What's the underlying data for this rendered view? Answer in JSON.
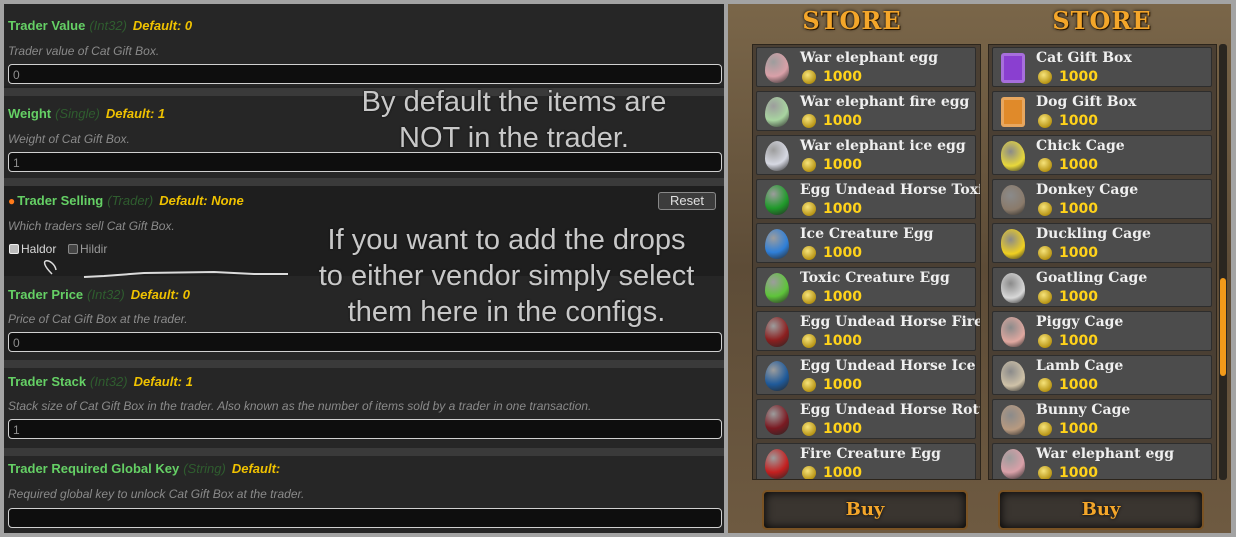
{
  "config": {
    "trader_value": {
      "title": "Trader Value",
      "type": "(Int32)",
      "default": "Default: 0",
      "description": "Trader value of Cat Gift Box.",
      "value": "0"
    },
    "weight": {
      "title": "Weight",
      "type": "(Single)",
      "default": "Default: 1",
      "description": "Weight of Cat Gift Box.",
      "value": "1"
    },
    "trader_selling": {
      "title": "Trader Selling",
      "type": "(Trader)",
      "default": "Default: None",
      "description": "Which traders sell Cat Gift Box.",
      "reset_label": "Reset",
      "options": [
        "Haldor",
        "Hildir"
      ]
    },
    "trader_price": {
      "title": "Trader Price",
      "type": "(Int32)",
      "default": "Default: 0",
      "description": "Price of Cat Gift Box at the trader.",
      "value": "0"
    },
    "trader_stack": {
      "title": "Trader Stack",
      "type": "(Int32)",
      "default": "Default: 1",
      "description": "Stack size of Cat Gift Box in the trader. Also known as the number of items sold by a trader in one transaction.",
      "value": "1"
    },
    "trader_required_key": {
      "title": "Trader Required Global Key",
      "type": "(String)",
      "default": "Default:",
      "description": "Required global key to unlock Cat Gift Box at the trader.",
      "value": ""
    }
  },
  "annotations": {
    "note1_line1": "By default the items are",
    "note1_line2": "NOT in the trader.",
    "note2_line1": "If you want to add the drops",
    "note2_line2": "to either vendor simply select",
    "note2_line3": "them here in the configs."
  },
  "store_left": {
    "title": "STORE",
    "buy_label": "Buy",
    "items": [
      {
        "name": "War elephant egg",
        "price": "1000",
        "icon": "pink-egg-icon",
        "color": "#d9a0a8"
      },
      {
        "name": "War elephant fire egg",
        "price": "1000",
        "icon": "pale-green-egg-icon",
        "color": "#a8d4a0"
      },
      {
        "name": "War elephant ice egg",
        "price": "1000",
        "icon": "white-egg-icon",
        "color": "#d6d8e2"
      },
      {
        "name": "Egg Undead Horse Toxic",
        "price": "1000",
        "icon": "green-egg-icon",
        "color": "#1f9a2a"
      },
      {
        "name": "Ice Creature Egg",
        "price": "1000",
        "icon": "blue-egg-icon",
        "color": "#2f7fd8"
      },
      {
        "name": "Toxic Creature Egg",
        "price": "1000",
        "icon": "lime-egg-icon",
        "color": "#5ec43a"
      },
      {
        "name": "Egg Undead Horse Fire",
        "price": "1000",
        "icon": "dark-red-egg-icon",
        "color": "#8c1f1f"
      },
      {
        "name": "Egg Undead Horse Ice",
        "price": "1000",
        "icon": "dark-blue-egg-icon",
        "color": "#1f5a9a"
      },
      {
        "name": "Egg Undead Horse Rotten",
        "price": "1000",
        "icon": "maroon-egg-icon",
        "color": "#7a1a22"
      },
      {
        "name": "Fire Creature Egg",
        "price": "1000",
        "icon": "red-egg-icon",
        "color": "#c42020"
      }
    ]
  },
  "store_right": {
    "title": "STORE",
    "buy_label": "Buy",
    "items": [
      {
        "name": "Cat Gift Box",
        "price": "1000",
        "icon": "purple-gift-box-icon",
        "color": "#8a3fd0"
      },
      {
        "name": "Dog Gift Box",
        "price": "1000",
        "icon": "orange-gift-box-icon",
        "color": "#e08a2a"
      },
      {
        "name": "Chick Cage",
        "price": "1000",
        "icon": "chick-icon",
        "color": "#e8d83a"
      },
      {
        "name": "Donkey Cage",
        "price": "1000",
        "icon": "donkey-icon",
        "color": "#8a7a6a"
      },
      {
        "name": "Duckling Cage",
        "price": "1000",
        "icon": "duckling-icon",
        "color": "#f0d020"
      },
      {
        "name": "Goatling Cage",
        "price": "1000",
        "icon": "goat-icon",
        "color": "#d8d8d8"
      },
      {
        "name": "Piggy Cage",
        "price": "1000",
        "icon": "pig-icon",
        "color": "#e0a8a0"
      },
      {
        "name": "Lamb Cage",
        "price": "1000",
        "icon": "lamb-icon",
        "color": "#cfc2a8"
      },
      {
        "name": "Bunny Cage",
        "price": "1000",
        "icon": "bunny-icon",
        "color": "#b89a80"
      },
      {
        "name": "War elephant egg",
        "price": "1000",
        "icon": "pink-egg-icon",
        "color": "#d9a0a8"
      }
    ]
  }
}
